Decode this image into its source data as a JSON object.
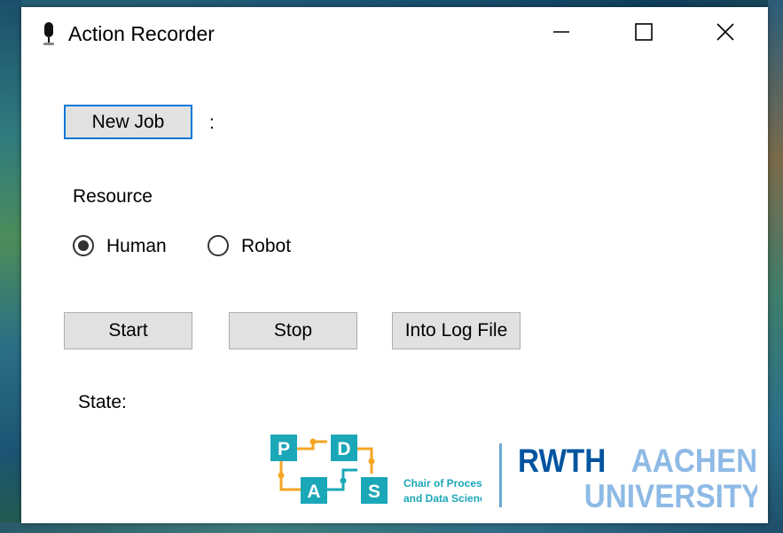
{
  "window": {
    "title": "Action Recorder",
    "controls": [
      "minimize",
      "maximize",
      "close"
    ]
  },
  "job": {
    "new_job_label": "New Job",
    "job_value": ":"
  },
  "resource": {
    "label": "Resource",
    "options": [
      {
        "label": "Human",
        "selected": true
      },
      {
        "label": "Robot",
        "selected": false
      }
    ]
  },
  "actions": {
    "start_label": "Start",
    "stop_label": "Stop",
    "log_label": "Into Log File"
  },
  "status": {
    "state_label": "State:"
  },
  "logos": {
    "pdas_letters": [
      "P",
      "D",
      "A",
      "S"
    ],
    "pdas_text_line1": "Chair of Process",
    "pdas_text_line2": "and Data Science",
    "rwth_line1_a": "RWTH",
    "rwth_line1_b": "AACHEN",
    "rwth_line2": "UNIVERSITY"
  },
  "colors": {
    "focus_blue": "#0078d7",
    "pdas_teal": "#1aa7b8",
    "pdas_orange": "#f5a623",
    "rwth_dark_blue": "#00549f",
    "rwth_light_blue": "#8ebae5"
  }
}
